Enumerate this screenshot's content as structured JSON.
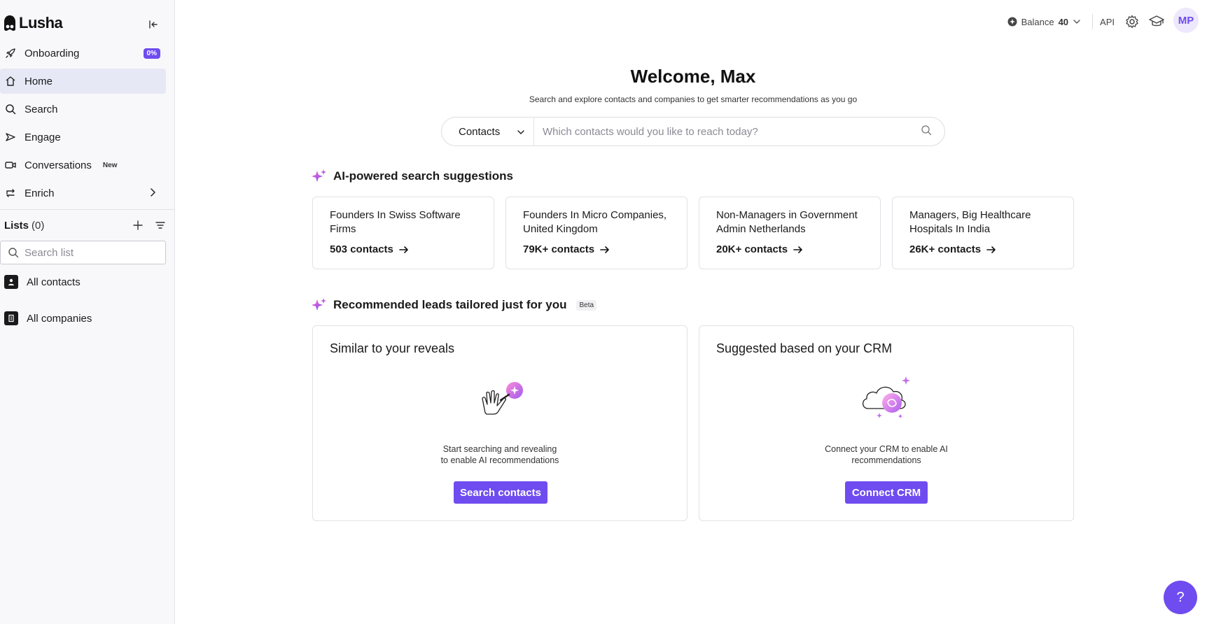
{
  "app": {
    "name": "Lusha"
  },
  "sidebar": {
    "nav": [
      {
        "label": "Onboarding",
        "icon": "rocket-icon",
        "badge": "0%"
      },
      {
        "label": "Home",
        "icon": "home-icon",
        "active": true
      },
      {
        "label": "Search",
        "icon": "search-icon"
      },
      {
        "label": "Engage",
        "icon": "engage-icon"
      },
      {
        "label": "Conversations",
        "icon": "video-icon",
        "badge": "New"
      },
      {
        "label": "Enrich",
        "icon": "enrich-icon"
      }
    ],
    "lists": {
      "title": "Lists",
      "count": "(0)",
      "search_placeholder": "Search list",
      "items": [
        {
          "label": "All contacts",
          "icon": "person-icon"
        },
        {
          "label": "All companies",
          "icon": "building-icon"
        }
      ]
    }
  },
  "topbar": {
    "balance_label": "Balance",
    "balance_value": "40",
    "api_label": "API",
    "avatar_initials": "MP"
  },
  "main": {
    "welcome": "Welcome, Max",
    "subtitle": "Search and explore contacts and companies to get smarter recommendations as you go",
    "search": {
      "type": "Contacts",
      "placeholder": "Which contacts would you like to reach today?"
    },
    "ai_section": {
      "title": "AI-powered search suggestions",
      "cards": [
        {
          "title": "Founders In Swiss Software Firms",
          "count": "503 contacts"
        },
        {
          "title": "Founders In Micro Companies, United Kingdom",
          "count": "79K+ contacts"
        },
        {
          "title": "Non-Managers in Government Admin Netherlands",
          "count": "20K+ contacts"
        },
        {
          "title": "Managers, Big Healthcare Hospitals In India",
          "count": "26K+ contacts"
        }
      ]
    },
    "rec_section": {
      "title": "Recommended leads tailored just for you",
      "badge": "Beta",
      "cards": [
        {
          "title": "Similar to your reveals",
          "desc_line1": "Start searching and revealing",
          "desc_line2": "to enable AI recommendations",
          "cta": "Search contacts"
        },
        {
          "title": "Suggested based on your CRM",
          "desc_line1": "Connect your CRM to enable AI",
          "desc_line2": "recommendations",
          "cta": "Connect CRM"
        }
      ]
    }
  },
  "help": {
    "label": "?"
  },
  "colors": {
    "accent": "#6f4cf0",
    "active_bg": "#e6e8f5",
    "sidebar_bg": "#f8f8fa"
  }
}
